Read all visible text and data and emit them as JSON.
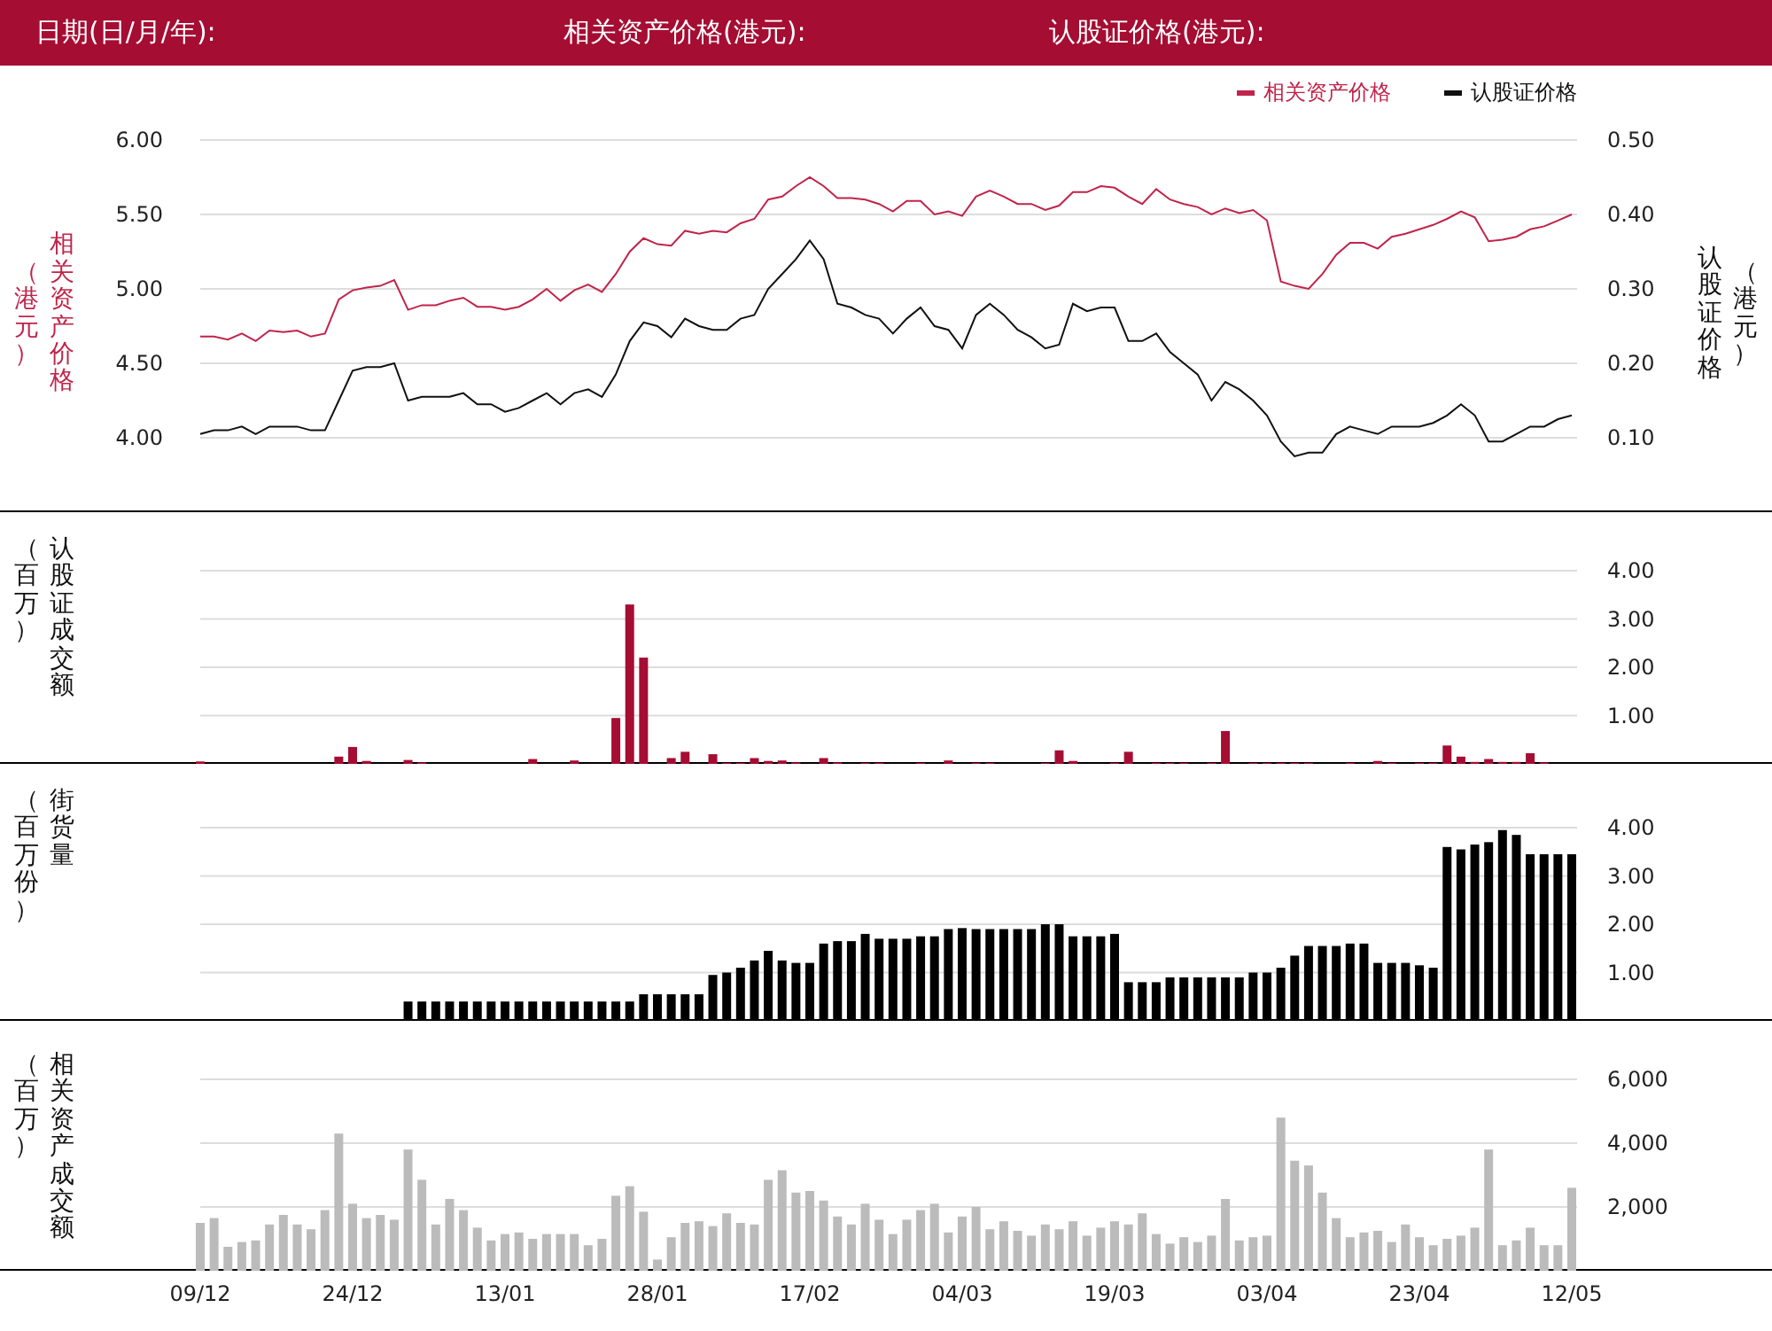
{
  "header": {
    "date_label": "日期(日/月/年):",
    "asset_price_label": "相关资产价格(港元):",
    "warrant_price_label": "认股证价格(港元):"
  },
  "price_chart": {
    "left_axis": {
      "label": "相关资产价格",
      "unit": "（港元）"
    },
    "right_axis": {
      "label": "认股证价格",
      "unit": "（港元）"
    },
    "chart_data": {
      "type": "line",
      "grid": true,
      "ylim": [
        3.5,
        6
      ],
      "yticks": [
        {
          "value": 4,
          "label": "4.00"
        },
        {
          "value": 4.5,
          "label": "4.50"
        },
        {
          "value": 5,
          "label": "5.00"
        },
        {
          "value": 5.5,
          "label": "5.50"
        },
        {
          "value": 6,
          "label": "6.00"
        }
      ],
      "y2lim": [
        0,
        0.5
      ],
      "y2ticks": [
        {
          "value": 0.1,
          "label": "0.10"
        },
        {
          "value": 0.2,
          "label": "0.20"
        },
        {
          "value": 0.3,
          "label": "0.30"
        },
        {
          "value": 0.4,
          "label": "0.40"
        },
        {
          "value": 0.5,
          "label": "0.50"
        }
      ],
      "series": [
        {
          "name": "相关资产价格",
          "color": "#c0244a",
          "values": [
            4.68,
            4.68,
            4.66,
            4.7,
            4.65,
            4.72,
            4.71,
            4.72,
            4.68,
            4.7,
            4.93,
            4.99,
            5.01,
            5.02,
            5.06,
            4.86,
            4.89,
            4.89,
            4.92,
            4.94,
            4.88,
            4.88,
            4.86,
            4.88,
            4.93,
            5.0,
            4.92,
            4.99,
            5.03,
            4.98,
            5.1,
            5.25,
            5.34,
            5.3,
            5.29,
            5.39,
            5.37,
            5.39,
            5.38,
            5.44,
            5.47,
            5.6,
            5.62,
            5.69,
            5.75,
            5.69,
            5.61,
            5.61,
            5.6,
            5.57,
            5.52,
            5.59,
            5.59,
            5.5,
            5.52,
            5.49,
            5.62,
            5.66,
            5.62,
            5.57,
            5.57,
            5.53,
            5.56,
            5.65,
            5.65,
            5.69,
            5.68,
            5.62,
            5.57,
            5.67,
            5.6,
            5.57,
            5.55,
            5.5,
            5.54,
            5.51,
            5.53,
            5.46,
            5.05,
            5.02,
            5.0,
            5.1,
            5.23,
            5.31,
            5.31,
            5.27,
            5.35,
            5.37,
            5.4,
            5.43,
            5.47,
            5.52,
            5.48,
            5.32,
            5.33,
            5.35,
            5.4,
            5.42,
            5.46,
            5.5
          ]
        },
        {
          "name": "认股证价格",
          "color": "#111111",
          "axis": "y2",
          "values": [
            0.105,
            0.11,
            0.11,
            0.115,
            0.105,
            0.115,
            0.115,
            0.115,
            0.11,
            0.11,
            0.15,
            0.19,
            0.195,
            0.195,
            0.2,
            0.15,
            0.155,
            0.155,
            0.155,
            0.16,
            0.145,
            0.145,
            0.135,
            0.14,
            0.15,
            0.16,
            0.145,
            0.16,
            0.165,
            0.155,
            0.185,
            0.23,
            0.255,
            0.25,
            0.235,
            0.26,
            0.25,
            0.245,
            0.245,
            0.26,
            0.265,
            0.3,
            0.32,
            0.34,
            0.365,
            0.34,
            0.28,
            0.275,
            0.265,
            0.26,
            0.24,
            0.26,
            0.275,
            0.25,
            0.245,
            0.22,
            0.265,
            0.28,
            0.265,
            0.245,
            0.235,
            0.22,
            0.225,
            0.28,
            0.27,
            0.275,
            0.275,
            0.23,
            0.23,
            0.24,
            0.215,
            0.2,
            0.185,
            0.15,
            0.175,
            0.165,
            0.15,
            0.13,
            0.095,
            0.075,
            0.08,
            0.08,
            0.105,
            0.115,
            0.11,
            0.105,
            0.115,
            0.115,
            0.115,
            0.12,
            0.13,
            0.145,
            0.13,
            0.095,
            0.095,
            0.105,
            0.115,
            0.115,
            0.125,
            0.13
          ]
        }
      ]
    }
  },
  "volume_charts": [
    {
      "unit": "（百万）",
      "chart_data": {
        "type": "bar",
        "grid": true,
        "ylim": [
          0,
          4
        ],
        "yticks": [
          {
            "value": 1,
            "label": "1.00"
          },
          {
            "value": 2,
            "label": "2.00"
          },
          {
            "value": 3,
            "label": "3.00"
          },
          {
            "value": 4,
            "label": "4.00"
          }
        ],
        "series": [
          {
            "name": "认股证成交额",
            "color": "#a50d33",
            "values": [
              0.05,
              0,
              0,
              0,
              0,
              0,
              0,
              0,
              0,
              0,
              0.15,
              0.35,
              0.06,
              0,
              0,
              0.08,
              0.03,
              0,
              0,
              0,
              0,
              0,
              0,
              0,
              0.1,
              0,
              0,
              0.07,
              0,
              0,
              0.95,
              3.3,
              2.2,
              0,
              0.12,
              0.25,
              0,
              0.2,
              0.02,
              0.02,
              0.12,
              0.06,
              0.07,
              0.03,
              0,
              0.12,
              0.03,
              0,
              0.02,
              0.02,
              0,
              0,
              0.02,
              0,
              0.07,
              0,
              0.02,
              0.02,
              0,
              0,
              0,
              0.02,
              0.28,
              0.06,
              0,
              0,
              0.02,
              0.25,
              0,
              0.02,
              0.02,
              0.02,
              0,
              0.02,
              0.68,
              0,
              0.02,
              0.02,
              0.02,
              0.02,
              0.02,
              0,
              0,
              0.02,
              0,
              0.06,
              0.02,
              0,
              0.02,
              0.02,
              0.38,
              0.15,
              0.04,
              0.1,
              0.04,
              0.04,
              0.22,
              0.03,
              0,
              0
            ]
          }
        ]
      }
    },
    {
      "unit": "（百万份）",
      "chart_data": {
        "type": "bar",
        "grid": true,
        "ylim": [
          0,
          4
        ],
        "yticks": [
          {
            "value": 1,
            "label": "1.00"
          },
          {
            "value": 2,
            "label": "2.00"
          },
          {
            "value": 3,
            "label": "3.00"
          },
          {
            "value": 4,
            "label": "4.00"
          }
        ],
        "series": [
          {
            "name": "街货量",
            "color": "#000000",
            "values": [
              0,
              0,
              0,
              0,
              0,
              0,
              0,
              0,
              0,
              0,
              0,
              0,
              0,
              0,
              0,
              0.4,
              0.4,
              0.4,
              0.4,
              0.4,
              0.4,
              0.4,
              0.4,
              0.4,
              0.4,
              0.4,
              0.4,
              0.4,
              0.4,
              0.4,
              0.4,
              0.4,
              0.55,
              0.55,
              0.55,
              0.55,
              0.55,
              0.95,
              1.0,
              1.1,
              1.25,
              1.45,
              1.25,
              1.2,
              1.2,
              1.6,
              1.65,
              1.65,
              1.8,
              1.7,
              1.7,
              1.7,
              1.75,
              1.75,
              1.9,
              1.92,
              1.9,
              1.9,
              1.9,
              1.9,
              1.9,
              2.0,
              2.0,
              1.75,
              1.75,
              1.75,
              1.8,
              0.8,
              0.8,
              0.8,
              0.9,
              0.9,
              0.9,
              0.9,
              0.9,
              0.9,
              1.0,
              1.0,
              1.1,
              1.35,
              1.55,
              1.55,
              1.55,
              1.6,
              1.6,
              1.2,
              1.2,
              1.2,
              1.15,
              1.1,
              3.6,
              3.55,
              3.65,
              3.7,
              3.95,
              3.85,
              3.45,
              3.45,
              3.45,
              3.45
            ]
          }
        ]
      }
    },
    {
      "unit": "（百万）",
      "chart_data": {
        "type": "bar",
        "grid": true,
        "ylim": [
          0,
          6000
        ],
        "yticks": [
          {
            "value": 2000,
            "label": "2,000"
          },
          {
            "value": 4000,
            "label": "4,000"
          },
          {
            "value": 6000,
            "label": "6,000"
          }
        ],
        "series": [
          {
            "name": "相关资产成交额",
            "color": "#bbbbbb",
            "values": [
              1500,
              1650,
              750,
              900,
              950,
              1450,
              1750,
              1450,
              1300,
              1900,
              4300,
              2100,
              1650,
              1750,
              1600,
              3800,
              2850,
              1450,
              2250,
              1900,
              1350,
              950,
              1150,
              1200,
              1000,
              1150,
              1150,
              1150,
              800,
              1000,
              2350,
              2650,
              1850,
              350,
              1050,
              1500,
              1550,
              1400,
              1800,
              1500,
              1450,
              2850,
              3150,
              2450,
              2500,
              2200,
              1700,
              1450,
              2100,
              1600,
              1150,
              1600,
              1900,
              2100,
              1200,
              1700,
              2000,
              1300,
              1550,
              1250,
              1100,
              1450,
              1300,
              1550,
              1100,
              1350,
              1550,
              1450,
              1800,
              1150,
              850,
              1050,
              900,
              1100,
              2250,
              950,
              1050,
              1100,
              4800,
              3450,
              3300,
              2450,
              1650,
              1050,
              1200,
              1250,
              900,
              1450,
              1050,
              800,
              1000,
              1100,
              1350,
              3800,
              800,
              950,
              1350,
              800,
              800,
              2600
            ]
          }
        ]
      }
    }
  ],
  "date_axis_labels": [
    "09/12",
    "24/12",
    "13/01",
    "28/01",
    "17/02",
    "04/03",
    "19/03",
    "03/04",
    "23/04",
    "12/05"
  ]
}
